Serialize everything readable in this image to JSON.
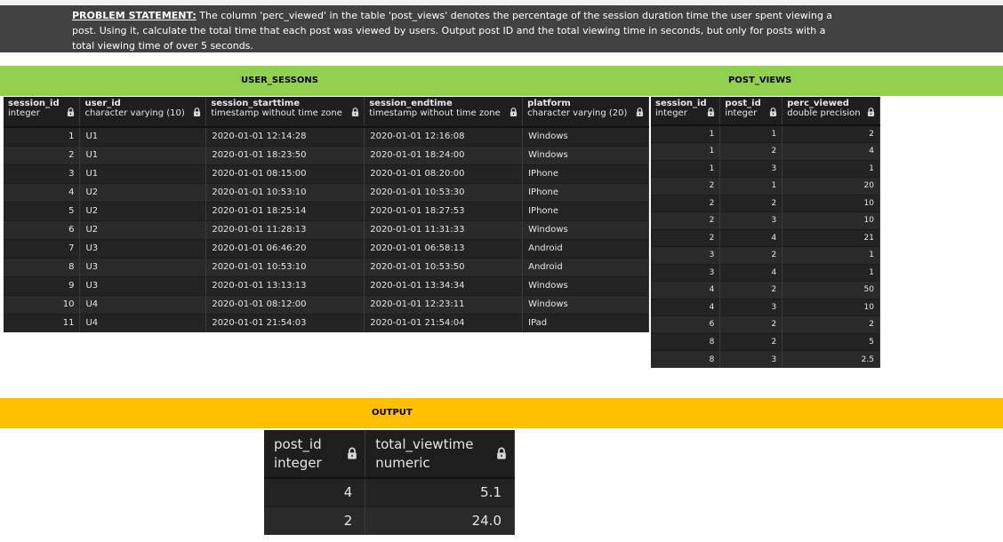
{
  "problem": {
    "label": "PROBLEM STATEMENT:",
    "text": " The column 'perc_viewed' in the table 'post_views' denotes the percentage of the session duration time the user spent viewing a post. Using it, calculate the total time that each post was viewed by users. Output post ID and the total viewing time in seconds, but only for posts with a total viewing time of over 5 seconds."
  },
  "sections": {
    "user_sessions_title": "USER_SESSONS",
    "post_views_title": "POST_VIEWS",
    "output_title": "OUTPUT"
  },
  "user_sessions": {
    "columns": [
      {
        "name": "session_id",
        "type": "integer"
      },
      {
        "name": "user_id",
        "type": "character varying (10)"
      },
      {
        "name": "session_starttime",
        "type": "timestamp without time zone"
      },
      {
        "name": "session_endtime",
        "type": "timestamp without time zone"
      },
      {
        "name": "platform",
        "type": "character varying (20)"
      }
    ],
    "rows": [
      [
        "1",
        "U1",
        "2020-01-01 12:14:28",
        "2020-01-01 12:16:08",
        "Windows"
      ],
      [
        "2",
        "U1",
        "2020-01-01 18:23:50",
        "2020-01-01 18:24:00",
        "Windows"
      ],
      [
        "3",
        "U1",
        "2020-01-01 08:15:00",
        "2020-01-01 08:20:00",
        "IPhone"
      ],
      [
        "4",
        "U2",
        "2020-01-01 10:53:10",
        "2020-01-01 10:53:30",
        "IPhone"
      ],
      [
        "5",
        "U2",
        "2020-01-01 18:25:14",
        "2020-01-01 18:27:53",
        "IPhone"
      ],
      [
        "6",
        "U2",
        "2020-01-01 11:28:13",
        "2020-01-01 11:31:33",
        "Windows"
      ],
      [
        "7",
        "U3",
        "2020-01-01 06:46:20",
        "2020-01-01 06:58:13",
        "Android"
      ],
      [
        "8",
        "U3",
        "2020-01-01 10:53:10",
        "2020-01-01 10:53:50",
        "Android"
      ],
      [
        "9",
        "U3",
        "2020-01-01 13:13:13",
        "2020-01-01 13:34:34",
        "Windows"
      ],
      [
        "10",
        "U4",
        "2020-01-01 08:12:00",
        "2020-01-01 12:23:11",
        "Windows"
      ],
      [
        "11",
        "U4",
        "2020-01-01 21:54:03",
        "2020-01-01 21:54:04",
        "IPad"
      ]
    ]
  },
  "post_views": {
    "columns": [
      {
        "name": "session_id",
        "type": "integer"
      },
      {
        "name": "post_id",
        "type": "integer"
      },
      {
        "name": "perc_viewed",
        "type": "double precision"
      }
    ],
    "rows": [
      [
        "1",
        "1",
        "2"
      ],
      [
        "1",
        "2",
        "4"
      ],
      [
        "1",
        "3",
        "1"
      ],
      [
        "2",
        "1",
        "20"
      ],
      [
        "2",
        "2",
        "10"
      ],
      [
        "2",
        "3",
        "10"
      ],
      [
        "2",
        "4",
        "21"
      ],
      [
        "3",
        "2",
        "1"
      ],
      [
        "3",
        "4",
        "1"
      ],
      [
        "4",
        "2",
        "50"
      ],
      [
        "4",
        "3",
        "10"
      ],
      [
        "6",
        "2",
        "2"
      ],
      [
        "8",
        "2",
        "5"
      ],
      [
        "8",
        "3",
        "2.5"
      ]
    ]
  },
  "output": {
    "columns": [
      {
        "name": "post_id",
        "type": "integer"
      },
      {
        "name": "total_viewtime",
        "type": "numeric"
      }
    ],
    "rows": [
      [
        "4",
        "5.1"
      ],
      [
        "2",
        "24.0"
      ]
    ]
  },
  "icons": {
    "lock": "lock-icon"
  }
}
